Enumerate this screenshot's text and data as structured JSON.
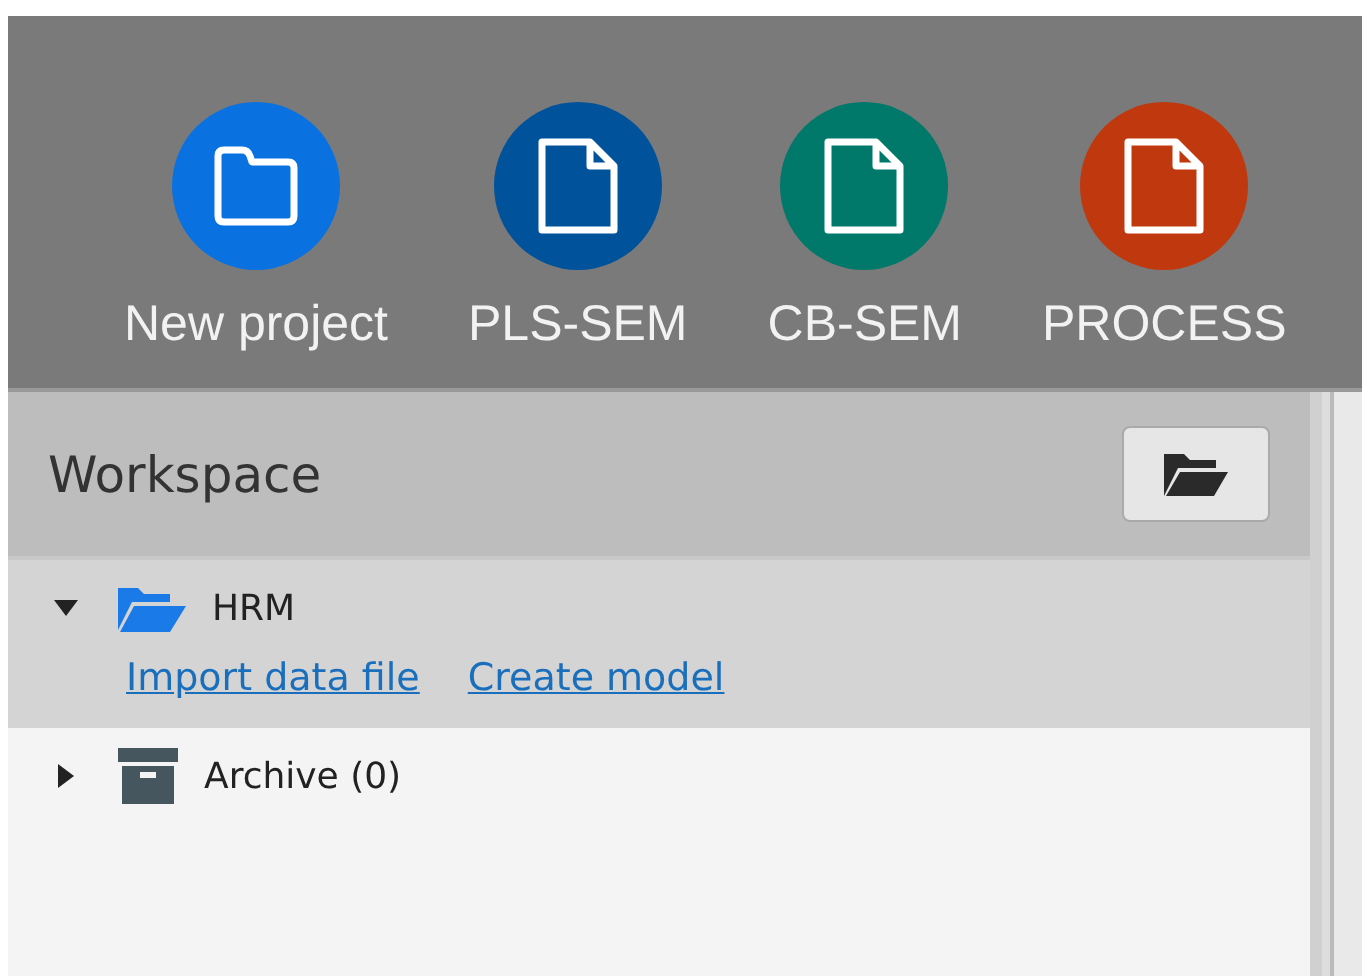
{
  "toolbar": {
    "buttons": [
      {
        "label": "New project",
        "kind": "folder",
        "color": "#0a72e0"
      },
      {
        "label": "PLS-SEM",
        "kind": "document",
        "color": "#00539a"
      },
      {
        "label": "CB-SEM",
        "kind": "document",
        "color": "#00786a"
      },
      {
        "label": "PROCESS",
        "kind": "document",
        "color": "#c0380e"
      }
    ]
  },
  "workspace": {
    "title": "Workspace",
    "items": [
      {
        "label": "HRM",
        "kind": "project",
        "expanded": true,
        "selected": true,
        "links": [
          "Import data file",
          "Create model"
        ]
      },
      {
        "label": "Archive (0)",
        "kind": "archive",
        "expanded": false,
        "selected": false
      }
    ]
  }
}
